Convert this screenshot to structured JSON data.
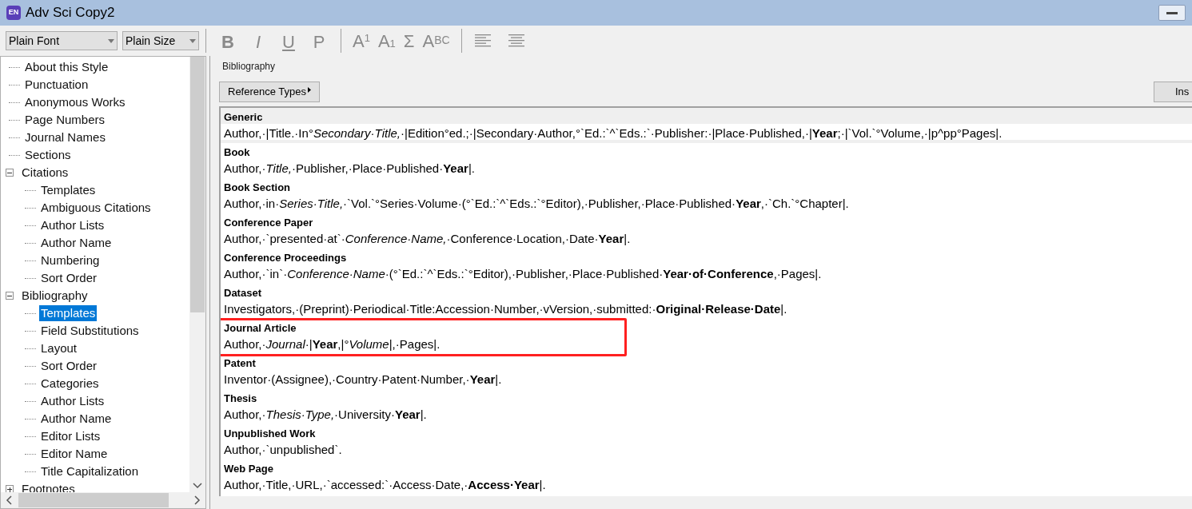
{
  "window": {
    "title": "Adv Sci Copy2",
    "app_badge": "EN"
  },
  "toolbar": {
    "font": "Plain Font",
    "size": "Plain Size",
    "format_buttons": [
      {
        "kind": "bold",
        "label": "B"
      },
      {
        "kind": "italic",
        "label": "I"
      },
      {
        "kind": "underline",
        "label": "U"
      },
      {
        "kind": "plain",
        "label": "P"
      }
    ],
    "script_buttons": [
      {
        "kind": "sup",
        "label": "A",
        "mark": "1"
      },
      {
        "kind": "sub",
        "label": "A",
        "mark": "1"
      },
      {
        "kind": "symbol",
        "label": "Σ"
      },
      {
        "kind": "smallcaps",
        "label": "A",
        "mark": "BC"
      }
    ]
  },
  "tree": [
    {
      "label": "About this Style",
      "selected": false
    },
    {
      "label": "Punctuation",
      "selected": false
    },
    {
      "label": "Anonymous Works",
      "selected": false
    },
    {
      "label": "Page Numbers",
      "selected": false
    },
    {
      "label": "Journal Names",
      "selected": false
    },
    {
      "label": "Sections",
      "selected": false
    },
    {
      "label": "Citations",
      "selected": false,
      "expanded": true,
      "children": [
        {
          "label": "Templates",
          "selected": false
        },
        {
          "label": "Ambiguous Citations",
          "selected": false
        },
        {
          "label": "Author Lists",
          "selected": false
        },
        {
          "label": "Author Name",
          "selected": false
        },
        {
          "label": "Numbering",
          "selected": false
        },
        {
          "label": "Sort Order",
          "selected": false
        }
      ]
    },
    {
      "label": "Bibliography",
      "selected": false,
      "expanded": true,
      "children": [
        {
          "label": "Templates",
          "selected": true
        },
        {
          "label": "Field Substitutions",
          "selected": false
        },
        {
          "label": "Layout",
          "selected": false
        },
        {
          "label": "Sort Order",
          "selected": false
        },
        {
          "label": "Categories",
          "selected": false
        },
        {
          "label": "Author Lists",
          "selected": false
        },
        {
          "label": "Author Name",
          "selected": false
        },
        {
          "label": "Editor Lists",
          "selected": false
        },
        {
          "label": "Editor Name",
          "selected": false
        },
        {
          "label": "Title Capitalization",
          "selected": false
        }
      ]
    },
    {
      "label": "Footnotes",
      "selected": false,
      "expanded": false
    }
  ],
  "panel": {
    "group_label": "Bibliography",
    "reference_types_button": "Reference Types",
    "insert_button": "Ins",
    "templates": [
      {
        "type": "Generic",
        "template": "Author,·|Title.·In°*Secondary·Title,*·|Edition°ed.;·|Secondary·Author,°`Ed.:`^`Eds.:`·Publisher:·|Place·Published,·|**Year**;·|`Vol.`°Volume,·|p^pp°Pages|.",
        "current": true,
        "highlighted": false
      },
      {
        "type": "Book",
        "template": "Author,·*Title,*·Publisher,·Place·Published·**Year**|.",
        "current": false,
        "highlighted": false
      },
      {
        "type": "Book Section",
        "template": "Author,·in·*Series·Title,*·`Vol.`°Series·Volume·(°`Ed.:`^`Eds.:`°Editor),·Publisher,·Place·Published·**Year**,·`Ch.`°Chapter|.",
        "current": false,
        "highlighted": false
      },
      {
        "type": "Conference Paper",
        "template": "Author,·`presented·at`·*Conference·Name,*·Conference·Location,·Date·**Year**|.",
        "current": false,
        "highlighted": false
      },
      {
        "type": "Conference Proceedings",
        "template": "Author,·`in`·*Conference·Name*·(°`Ed.:`^`Eds.:`°Editor),·Publisher,·Place·Published·**Year·of·Conference**,·Pages|.",
        "current": false,
        "highlighted": false
      },
      {
        "type": "Dataset",
        "template": "Investigators,·(Preprint)·Periodical·Title:Accession·Number,·vVersion,·submitted:·**Original·Release·Date**|.",
        "current": false,
        "highlighted": false
      },
      {
        "type": "Journal Article",
        "template": "Author,·*Journal*·|**Year**,|°*Volume*|,·Pages|.",
        "current": false,
        "highlighted": true
      },
      {
        "type": "Patent",
        "template": "Inventor·(Assignee),·Country·Patent·Number,·**Year**|.",
        "current": false,
        "highlighted": false
      },
      {
        "type": "Thesis",
        "template": "Author,·*Thesis·Type,*·University·**Year**|.",
        "current": false,
        "highlighted": false
      },
      {
        "type": "Unpublished Work",
        "template": "Author,·`unpublished`.",
        "current": false,
        "highlighted": false
      },
      {
        "type": "Web Page",
        "template": "Author,·Title,·URL,·`accessed:`·Access·Date,·**Access·Year**|.",
        "current": false,
        "highlighted": false
      }
    ]
  }
}
